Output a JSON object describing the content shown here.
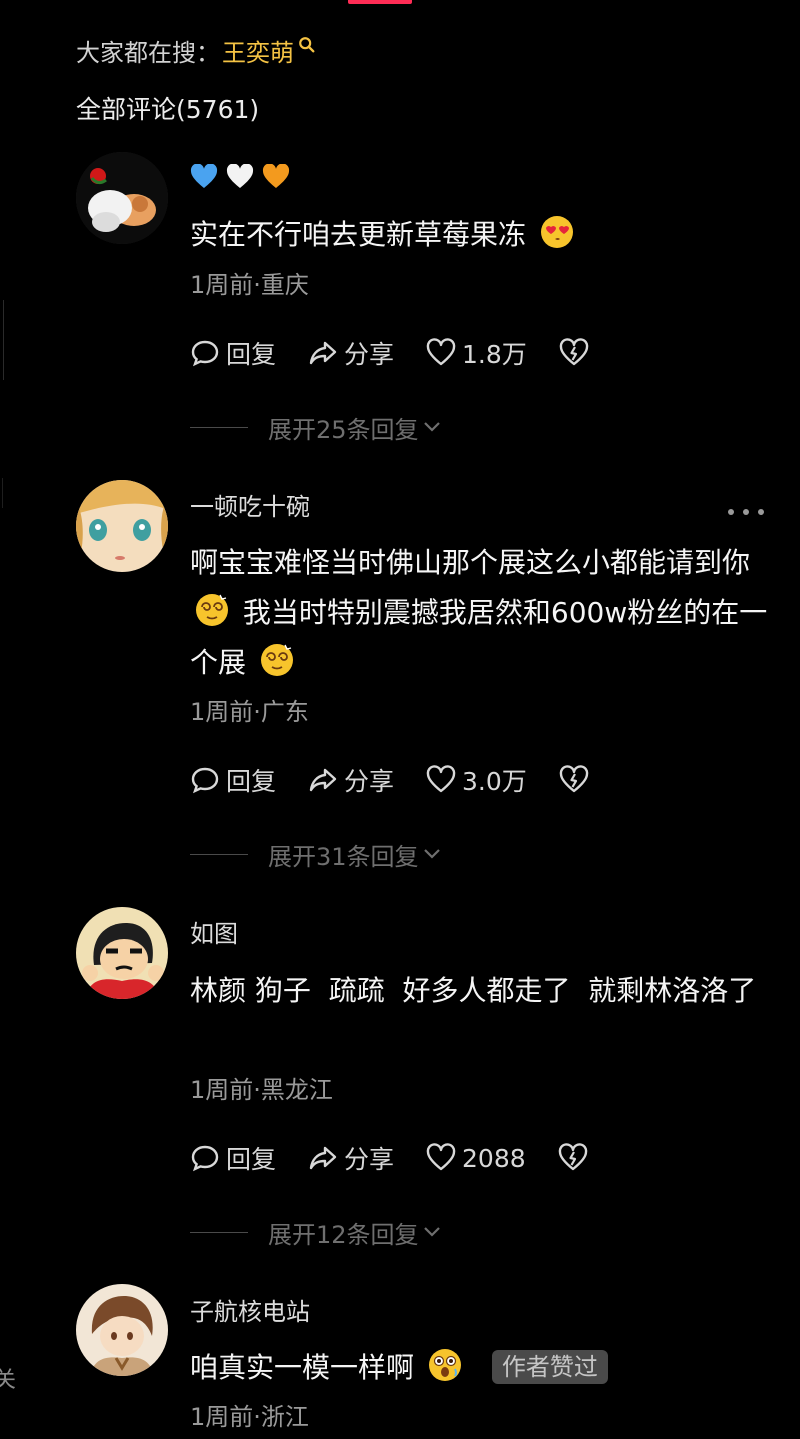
{
  "search_hint": {
    "prefix": "大家都在搜：",
    "term": "王奕萌",
    "term_color": "#f5c344"
  },
  "total_comments": "全部评论(5761)",
  "comments": [
    {
      "username": "",
      "hearts": [
        "blue-heart",
        "white-heart",
        "orange-heart"
      ],
      "text": "实在不行咱去更新草莓果冻",
      "text_parts": [
        "实在不行咱去更新草莓果冻"
      ],
      "emojis": [
        "heart-eyes-kiss-emoji"
      ],
      "meta": "1周前·重庆",
      "reply_label": "回复",
      "share_label": "分享",
      "likes": "1.8万",
      "expand_label": "展开25条回复"
    },
    {
      "username": "一顿吃十碗",
      "text_parts": [
        "啊宝宝难怪当时佛山那个展这么小都能请到你",
        "我当时特别震撼我居然和600w粉丝的在一个展",
        ""
      ],
      "emojis": [
        "dizzy-face-emoji",
        "dizzy-face-emoji"
      ],
      "meta": "1周前·广东",
      "reply_label": "回复",
      "share_label": "分享",
      "likes": "3.0万",
      "expand_label": "展开31条回复"
    },
    {
      "username": "如图",
      "text": "林颜 狗子  疏疏  好多人都走了  就剩林洛洛了",
      "meta": "1周前·黑龙江",
      "reply_label": "回复",
      "share_label": "分享",
      "likes": "2088",
      "expand_label": "展开12条回复"
    },
    {
      "username": "子航核电站",
      "text": "咱真实一模一样啊",
      "emojis": [
        "astonished-emoji"
      ],
      "badge": "作者赞过",
      "meta": "1周前·浙江"
    }
  ],
  "edge_char": "关"
}
